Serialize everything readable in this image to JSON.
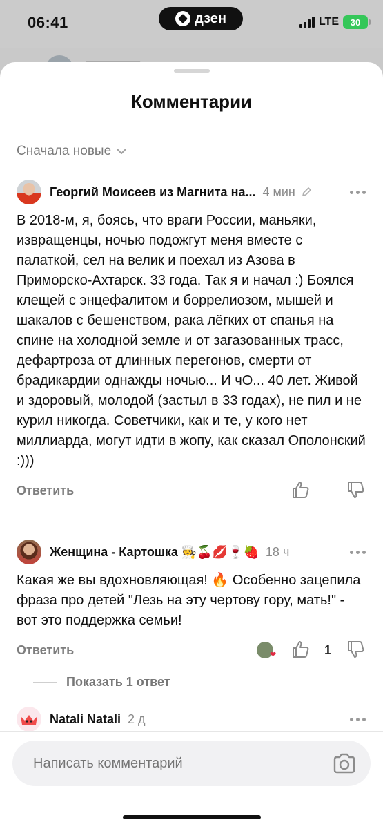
{
  "status_bar": {
    "time": "06:41",
    "app_pill": "дзен",
    "network": "LTE",
    "battery": "30"
  },
  "sheet": {
    "title": "Комментарии",
    "sort_label": "Сначала новые"
  },
  "comments": [
    {
      "author": "Георгий Моисеев из Магнита на...",
      "time": "4 мин",
      "text": "В 2018-м, я, боясь, что враги России, маньяки, извращенцы, ночью подожгут меня вместе с палаткой, сел на велик и поехал из Азова в Приморско-Ахтарск. 33 года. Так я и начал :) Боялся клещей с энцефалитом и боррелиозом, мышей и шакалов с бешенством, рака лёгких от спанья на спине на холодной земле и от загазованных трасс, дефартроза от длинных перегонов, смерти от брадикардии однажды ночью... И чО... 40 лет. Живой и здоровый, молодой (застыл в 33 годах), не пил и не курил никогда. Советчики, как и те, у кого нет миллиарда, могут идти в жопу, как сказал Ополонский :)))",
      "reply_label": "Ответить"
    },
    {
      "author": "Женщина - Картошка 🧑‍🍳🍒💋🍷🍓",
      "time": "18 ч",
      "text": "Какая же вы вдохновляющая! 🔥 Особенно зацепила фраза про детей \"Лезь на эту чертову гору, мать!\" - вот это поддержка семьи!",
      "reply_label": "Ответить",
      "likes": "1"
    },
    {
      "author": "Natali Natali",
      "time": "2 д"
    }
  ],
  "show_replies_label": "Показать 1 ответ",
  "composer": {
    "placeholder": "Написать комментарий"
  },
  "colors": {
    "accent_battery": "#35c759",
    "sheet_bg": "#ffffff",
    "muted_text": "#7e7e7e",
    "reaction_heart": "#e02b44"
  },
  "icons": [
    "dzen-logo-icon",
    "chevron-down-icon",
    "pencil-icon",
    "more-dots-icon",
    "thumbs-up-icon",
    "thumbs-down-icon",
    "camera-icon",
    "heart-icon"
  ]
}
